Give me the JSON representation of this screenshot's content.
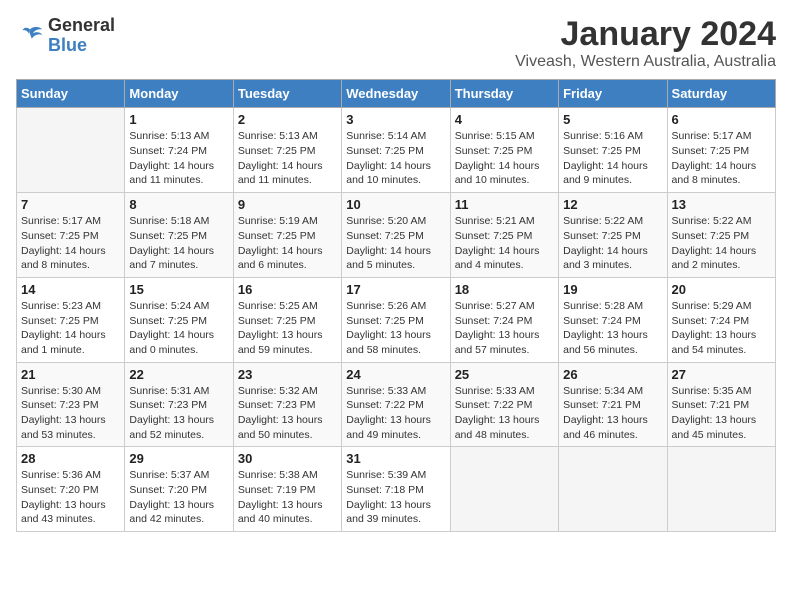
{
  "logo": {
    "text_general": "General",
    "text_blue": "Blue"
  },
  "title": "January 2024",
  "subtitle": "Viveash, Western Australia, Australia",
  "days_header": [
    "Sunday",
    "Monday",
    "Tuesday",
    "Wednesday",
    "Thursday",
    "Friday",
    "Saturday"
  ],
  "weeks": [
    [
      {
        "day": "",
        "info": ""
      },
      {
        "day": "1",
        "info": "Sunrise: 5:13 AM\nSunset: 7:24 PM\nDaylight: 14 hours\nand 11 minutes."
      },
      {
        "day": "2",
        "info": "Sunrise: 5:13 AM\nSunset: 7:25 PM\nDaylight: 14 hours\nand 11 minutes."
      },
      {
        "day": "3",
        "info": "Sunrise: 5:14 AM\nSunset: 7:25 PM\nDaylight: 14 hours\nand 10 minutes."
      },
      {
        "day": "4",
        "info": "Sunrise: 5:15 AM\nSunset: 7:25 PM\nDaylight: 14 hours\nand 10 minutes."
      },
      {
        "day": "5",
        "info": "Sunrise: 5:16 AM\nSunset: 7:25 PM\nDaylight: 14 hours\nand 9 minutes."
      },
      {
        "day": "6",
        "info": "Sunrise: 5:17 AM\nSunset: 7:25 PM\nDaylight: 14 hours\nand 8 minutes."
      }
    ],
    [
      {
        "day": "7",
        "info": "Sunrise: 5:17 AM\nSunset: 7:25 PM\nDaylight: 14 hours\nand 8 minutes."
      },
      {
        "day": "8",
        "info": "Sunrise: 5:18 AM\nSunset: 7:25 PM\nDaylight: 14 hours\nand 7 minutes."
      },
      {
        "day": "9",
        "info": "Sunrise: 5:19 AM\nSunset: 7:25 PM\nDaylight: 14 hours\nand 6 minutes."
      },
      {
        "day": "10",
        "info": "Sunrise: 5:20 AM\nSunset: 7:25 PM\nDaylight: 14 hours\nand 5 minutes."
      },
      {
        "day": "11",
        "info": "Sunrise: 5:21 AM\nSunset: 7:25 PM\nDaylight: 14 hours\nand 4 minutes."
      },
      {
        "day": "12",
        "info": "Sunrise: 5:22 AM\nSunset: 7:25 PM\nDaylight: 14 hours\nand 3 minutes."
      },
      {
        "day": "13",
        "info": "Sunrise: 5:22 AM\nSunset: 7:25 PM\nDaylight: 14 hours\nand 2 minutes."
      }
    ],
    [
      {
        "day": "14",
        "info": "Sunrise: 5:23 AM\nSunset: 7:25 PM\nDaylight: 14 hours\nand 1 minute."
      },
      {
        "day": "15",
        "info": "Sunrise: 5:24 AM\nSunset: 7:25 PM\nDaylight: 14 hours\nand 0 minutes."
      },
      {
        "day": "16",
        "info": "Sunrise: 5:25 AM\nSunset: 7:25 PM\nDaylight: 13 hours\nand 59 minutes."
      },
      {
        "day": "17",
        "info": "Sunrise: 5:26 AM\nSunset: 7:25 PM\nDaylight: 13 hours\nand 58 minutes."
      },
      {
        "day": "18",
        "info": "Sunrise: 5:27 AM\nSunset: 7:24 PM\nDaylight: 13 hours\nand 57 minutes."
      },
      {
        "day": "19",
        "info": "Sunrise: 5:28 AM\nSunset: 7:24 PM\nDaylight: 13 hours\nand 56 minutes."
      },
      {
        "day": "20",
        "info": "Sunrise: 5:29 AM\nSunset: 7:24 PM\nDaylight: 13 hours\nand 54 minutes."
      }
    ],
    [
      {
        "day": "21",
        "info": "Sunrise: 5:30 AM\nSunset: 7:23 PM\nDaylight: 13 hours\nand 53 minutes."
      },
      {
        "day": "22",
        "info": "Sunrise: 5:31 AM\nSunset: 7:23 PM\nDaylight: 13 hours\nand 52 minutes."
      },
      {
        "day": "23",
        "info": "Sunrise: 5:32 AM\nSunset: 7:23 PM\nDaylight: 13 hours\nand 50 minutes."
      },
      {
        "day": "24",
        "info": "Sunrise: 5:33 AM\nSunset: 7:22 PM\nDaylight: 13 hours\nand 49 minutes."
      },
      {
        "day": "25",
        "info": "Sunrise: 5:33 AM\nSunset: 7:22 PM\nDaylight: 13 hours\nand 48 minutes."
      },
      {
        "day": "26",
        "info": "Sunrise: 5:34 AM\nSunset: 7:21 PM\nDaylight: 13 hours\nand 46 minutes."
      },
      {
        "day": "27",
        "info": "Sunrise: 5:35 AM\nSunset: 7:21 PM\nDaylight: 13 hours\nand 45 minutes."
      }
    ],
    [
      {
        "day": "28",
        "info": "Sunrise: 5:36 AM\nSunset: 7:20 PM\nDaylight: 13 hours\nand 43 minutes."
      },
      {
        "day": "29",
        "info": "Sunrise: 5:37 AM\nSunset: 7:20 PM\nDaylight: 13 hours\nand 42 minutes."
      },
      {
        "day": "30",
        "info": "Sunrise: 5:38 AM\nSunset: 7:19 PM\nDaylight: 13 hours\nand 40 minutes."
      },
      {
        "day": "31",
        "info": "Sunrise: 5:39 AM\nSunset: 7:18 PM\nDaylight: 13 hours\nand 39 minutes."
      },
      {
        "day": "",
        "info": ""
      },
      {
        "day": "",
        "info": ""
      },
      {
        "day": "",
        "info": ""
      }
    ]
  ]
}
